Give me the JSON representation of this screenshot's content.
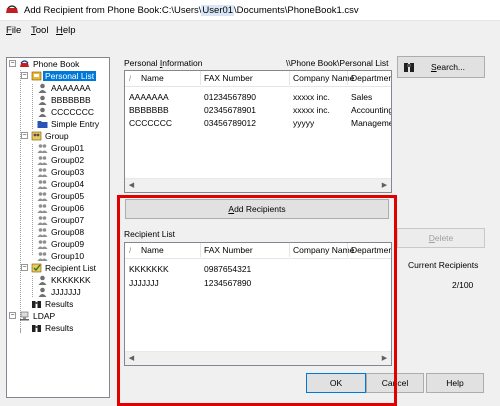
{
  "window": {
    "title_prefix": "Add Recipient from Phone Book:C:\\Users\\",
    "title_user": "User01",
    "title_suffix": "\\Documents\\PhoneBook1.csv"
  },
  "menu": [
    {
      "label": "File",
      "accel": "F",
      "rest": "ile"
    },
    {
      "label": "Tool",
      "accel": "T",
      "rest": "ool"
    },
    {
      "label": "Help",
      "accel": "H",
      "rest": "elp"
    }
  ],
  "tree": {
    "root": "Phone Book",
    "personal_list": "Personal List",
    "personal_entries": [
      "AAAAAAA",
      "BBBBBBB",
      "CCCCCCC"
    ],
    "simple_entry": "Simple Entry",
    "group": "Group",
    "groups": [
      "Group01",
      "Group02",
      "Group03",
      "Group04",
      "Group05",
      "Group06",
      "Group07",
      "Group08",
      "Group09",
      "Group10"
    ],
    "recipient_list": "Recipient List",
    "recipient_entries": [
      "KKKKKKK",
      "JJJJJJJ"
    ],
    "results": "Results",
    "ldap": "LDAP",
    "ldap_results": "Results"
  },
  "personal_info": {
    "label_prefix": "Personal ",
    "label_accel": "I",
    "label_suffix": "nformation",
    "path": "\\\\Phone Book\\Personal List",
    "columns": [
      "Name",
      "FAX Number",
      "Company Name",
      "Departmer"
    ],
    "rows": [
      [
        "AAAAAAA",
        "01234567890",
        "xxxxx inc.",
        "Sales"
      ],
      [
        "BBBBBBB",
        "02345678901",
        "xxxxx inc.",
        "Accounting"
      ],
      [
        "CCCCCCC",
        "03456789012",
        "yyyyy",
        "Manageme"
      ]
    ]
  },
  "buttons": {
    "search": {
      "accel": "S",
      "rest": "earch..."
    },
    "add_recipients": {
      "accel": "A",
      "rest": "dd Recipients"
    },
    "delete": {
      "accel": "D",
      "rest": "elete"
    },
    "ok": "OK",
    "cancel": "Cancel",
    "help": "Help"
  },
  "recipient_list": {
    "label": "Recipient List",
    "columns": [
      "Name",
      "FAX Number",
      "Company Name",
      "Departmer"
    ],
    "rows": [
      [
        "KKKKKKK",
        "0987654321",
        "",
        ""
      ],
      [
        "JJJJJJJ",
        "1234567890",
        "",
        ""
      ]
    ]
  },
  "current_recipients": {
    "label": "Current Recipients",
    "value": "2/100"
  },
  "colors": {
    "highlight_border": "#e00000",
    "selection": "#0078d7"
  }
}
